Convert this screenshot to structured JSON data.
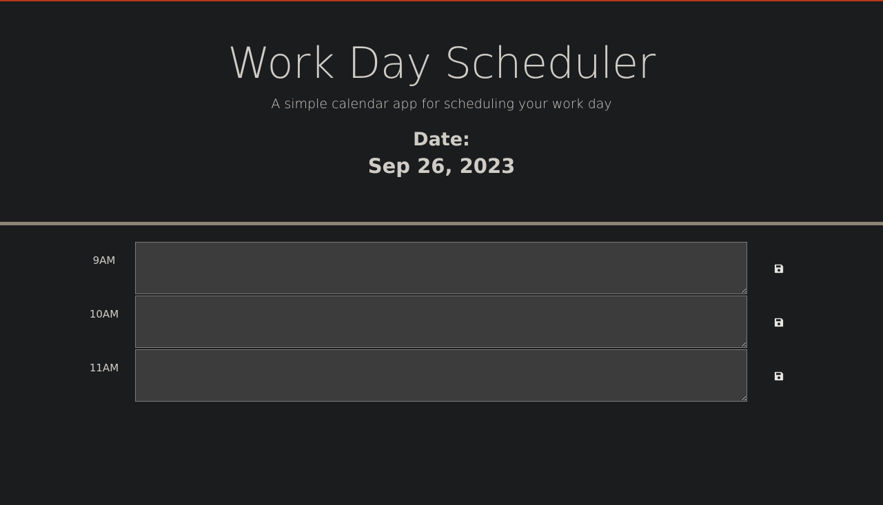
{
  "header": {
    "title": "Work Day Scheduler",
    "subtitle": "A simple calendar app for scheduling your work day",
    "date_label": "Date:",
    "date_value": "Sep 26, 2023"
  },
  "schedule": {
    "rows": [
      {
        "hour": "9AM",
        "entry_value": "",
        "save_icon": "floppy-disk-icon"
      },
      {
        "hour": "10AM",
        "entry_value": "",
        "save_icon": "floppy-disk-icon"
      },
      {
        "hour": "11AM",
        "entry_value": "",
        "save_icon": "floppy-disk-icon"
      }
    ]
  },
  "colors": {
    "background": "#1b1c1e",
    "accent_top_bar": "#b5391c",
    "divider": "#8d8577",
    "textarea_bg": "#3c3c3c",
    "text": "#cfccc6"
  }
}
